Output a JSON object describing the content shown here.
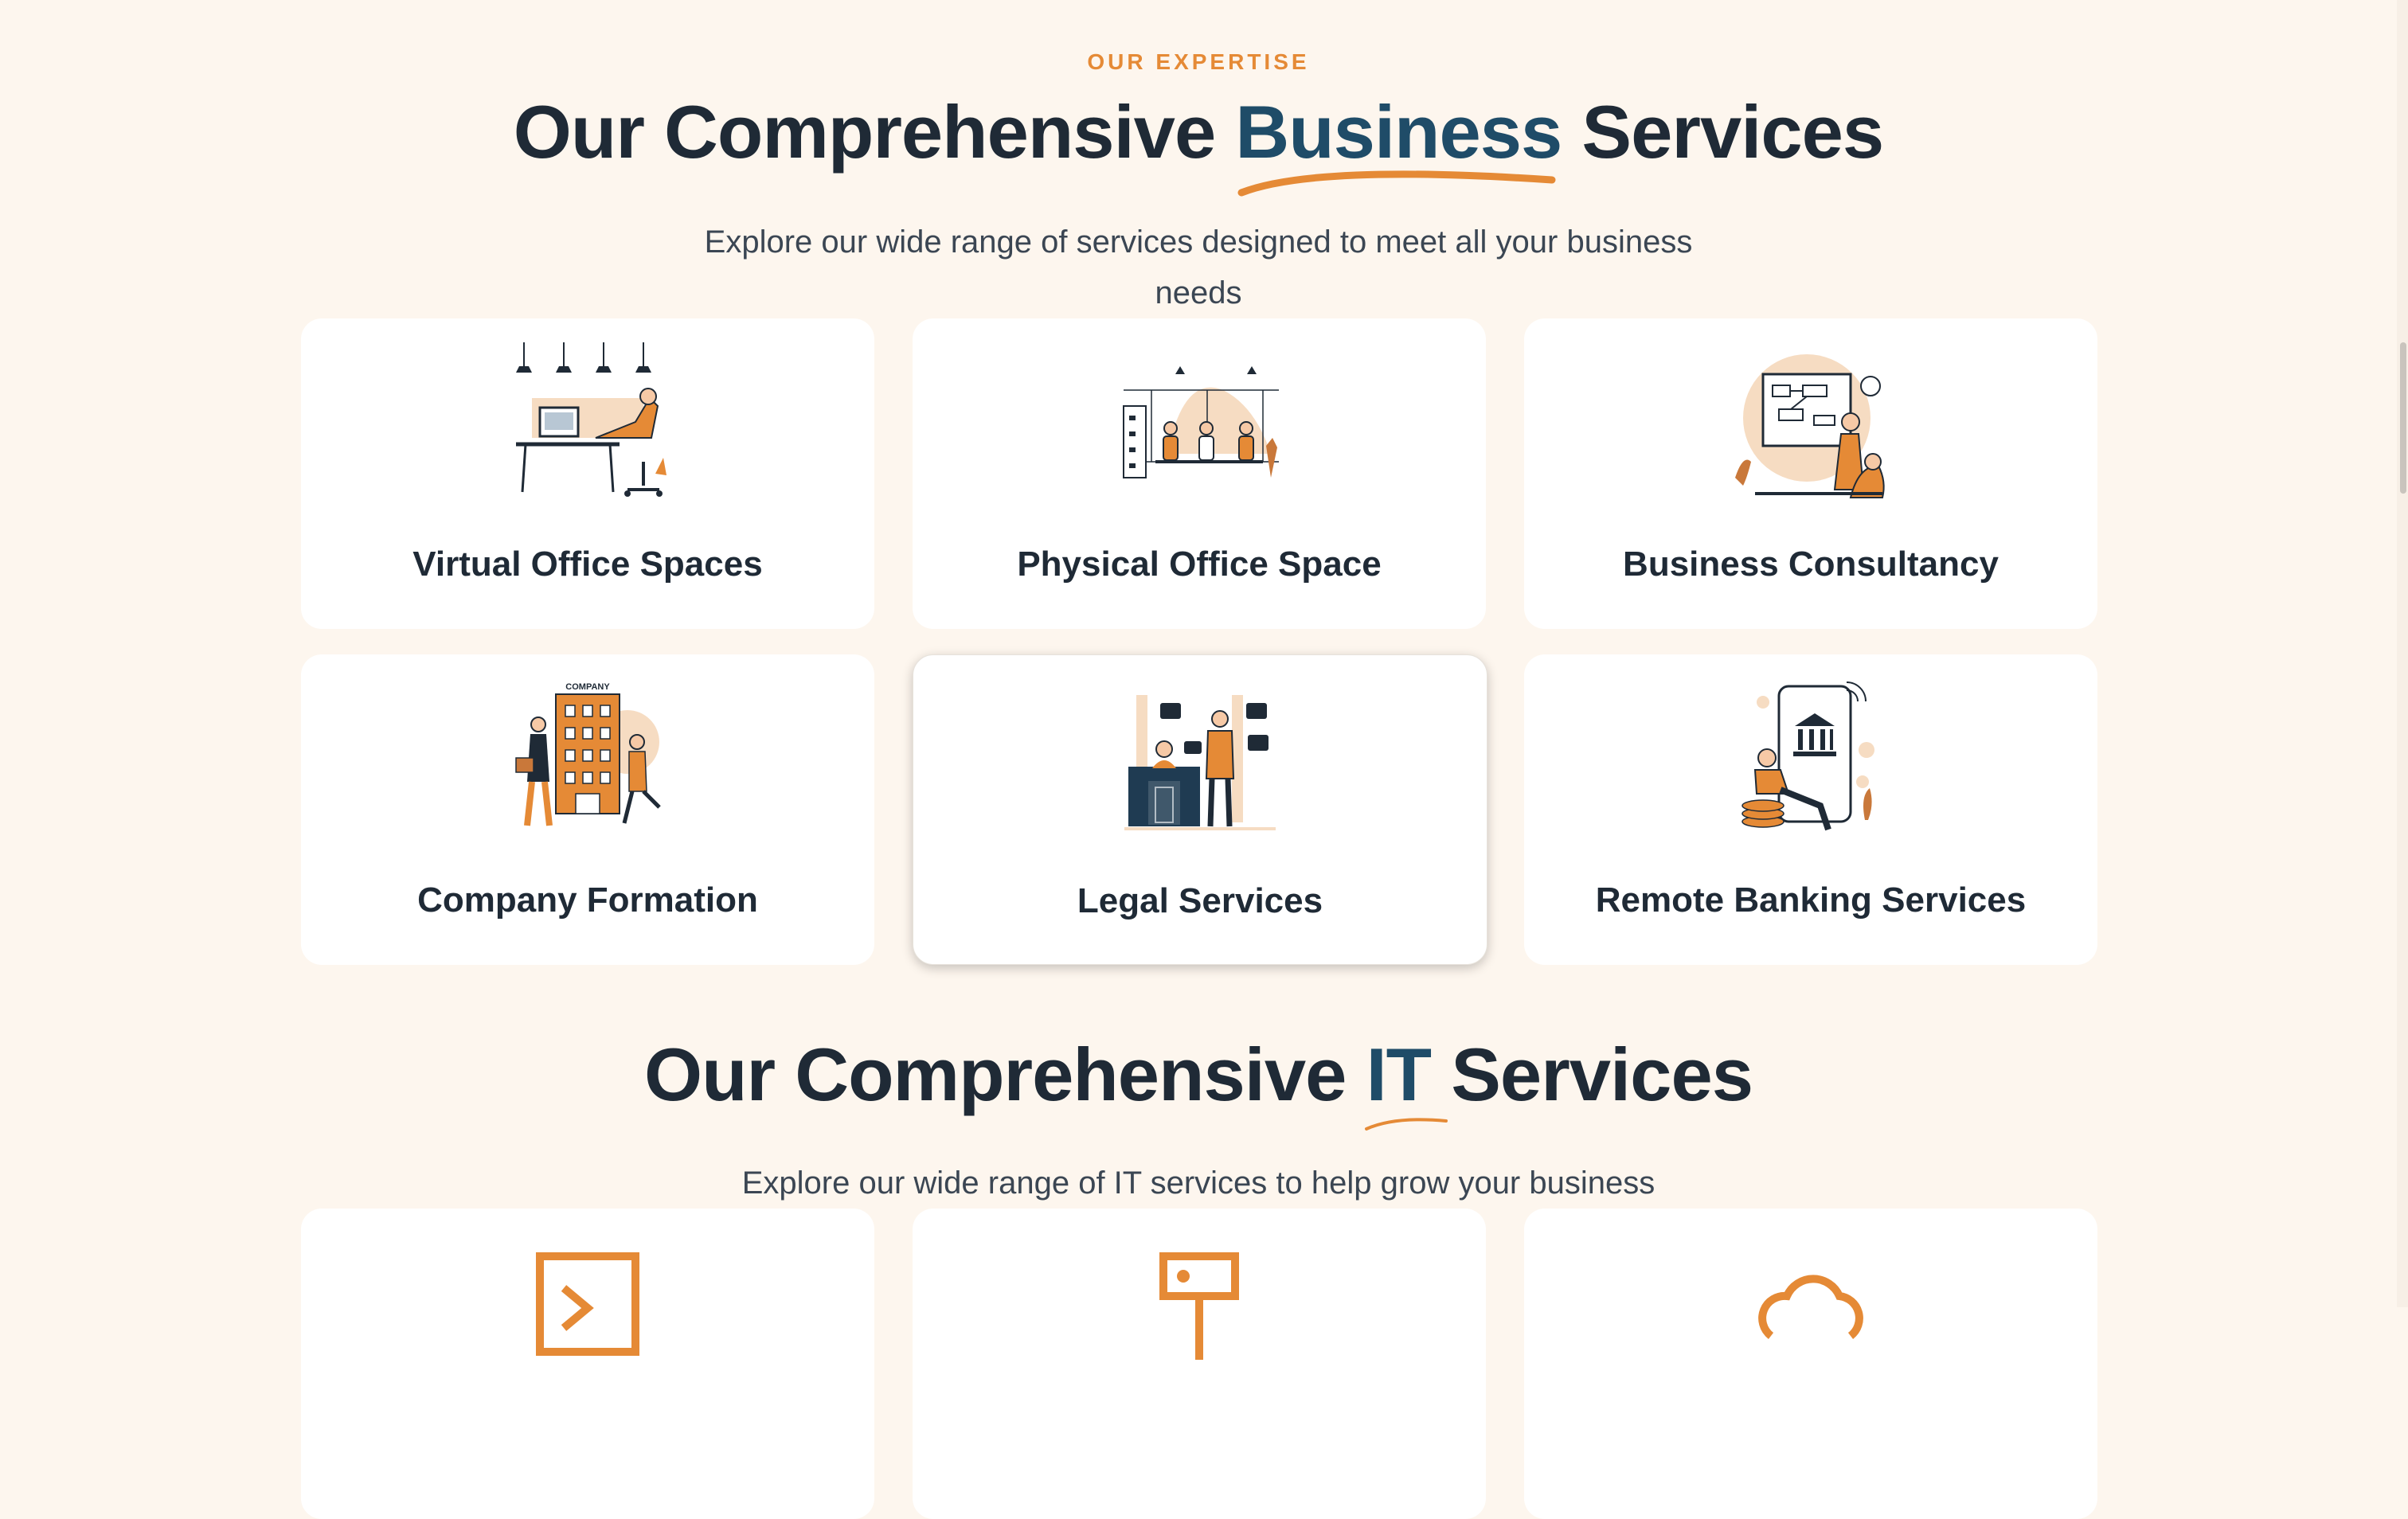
{
  "colors": {
    "accent": "#e58a36",
    "heading": "#1f2a36",
    "highlight": "#1f4c68",
    "background": "#fdf6ee"
  },
  "business": {
    "eyebrow": "OUR EXPERTISE",
    "title_before": "Our Comprehensive ",
    "title_highlight": "Business",
    "title_after": " Services",
    "subtitle_line1": "Explore our wide range of services designed to meet all your business",
    "subtitle_line2": "needs",
    "cards": [
      {
        "title": "Virtual Office Spaces",
        "icon": "virtual-office-illustration"
      },
      {
        "title": "Physical Office Space",
        "icon": "physical-office-illustration"
      },
      {
        "title": "Business Consultancy",
        "icon": "business-consultancy-illustration"
      },
      {
        "title": "Company Formation",
        "icon": "company-formation-illustration",
        "illustration_label": "COMPANY"
      },
      {
        "title": "Legal Services",
        "icon": "legal-services-illustration"
      },
      {
        "title": "Remote Banking Services",
        "icon": "remote-banking-illustration"
      }
    ]
  },
  "it": {
    "title_before": "Our Comprehensive ",
    "title_highlight": "IT",
    "title_after": " Services",
    "subtitle": "Explore our wide range of IT services to help grow your business",
    "cards": [
      {
        "icon": "terminal-icon"
      },
      {
        "icon": "signpost-icon"
      },
      {
        "icon": "cloud-icon"
      }
    ]
  }
}
